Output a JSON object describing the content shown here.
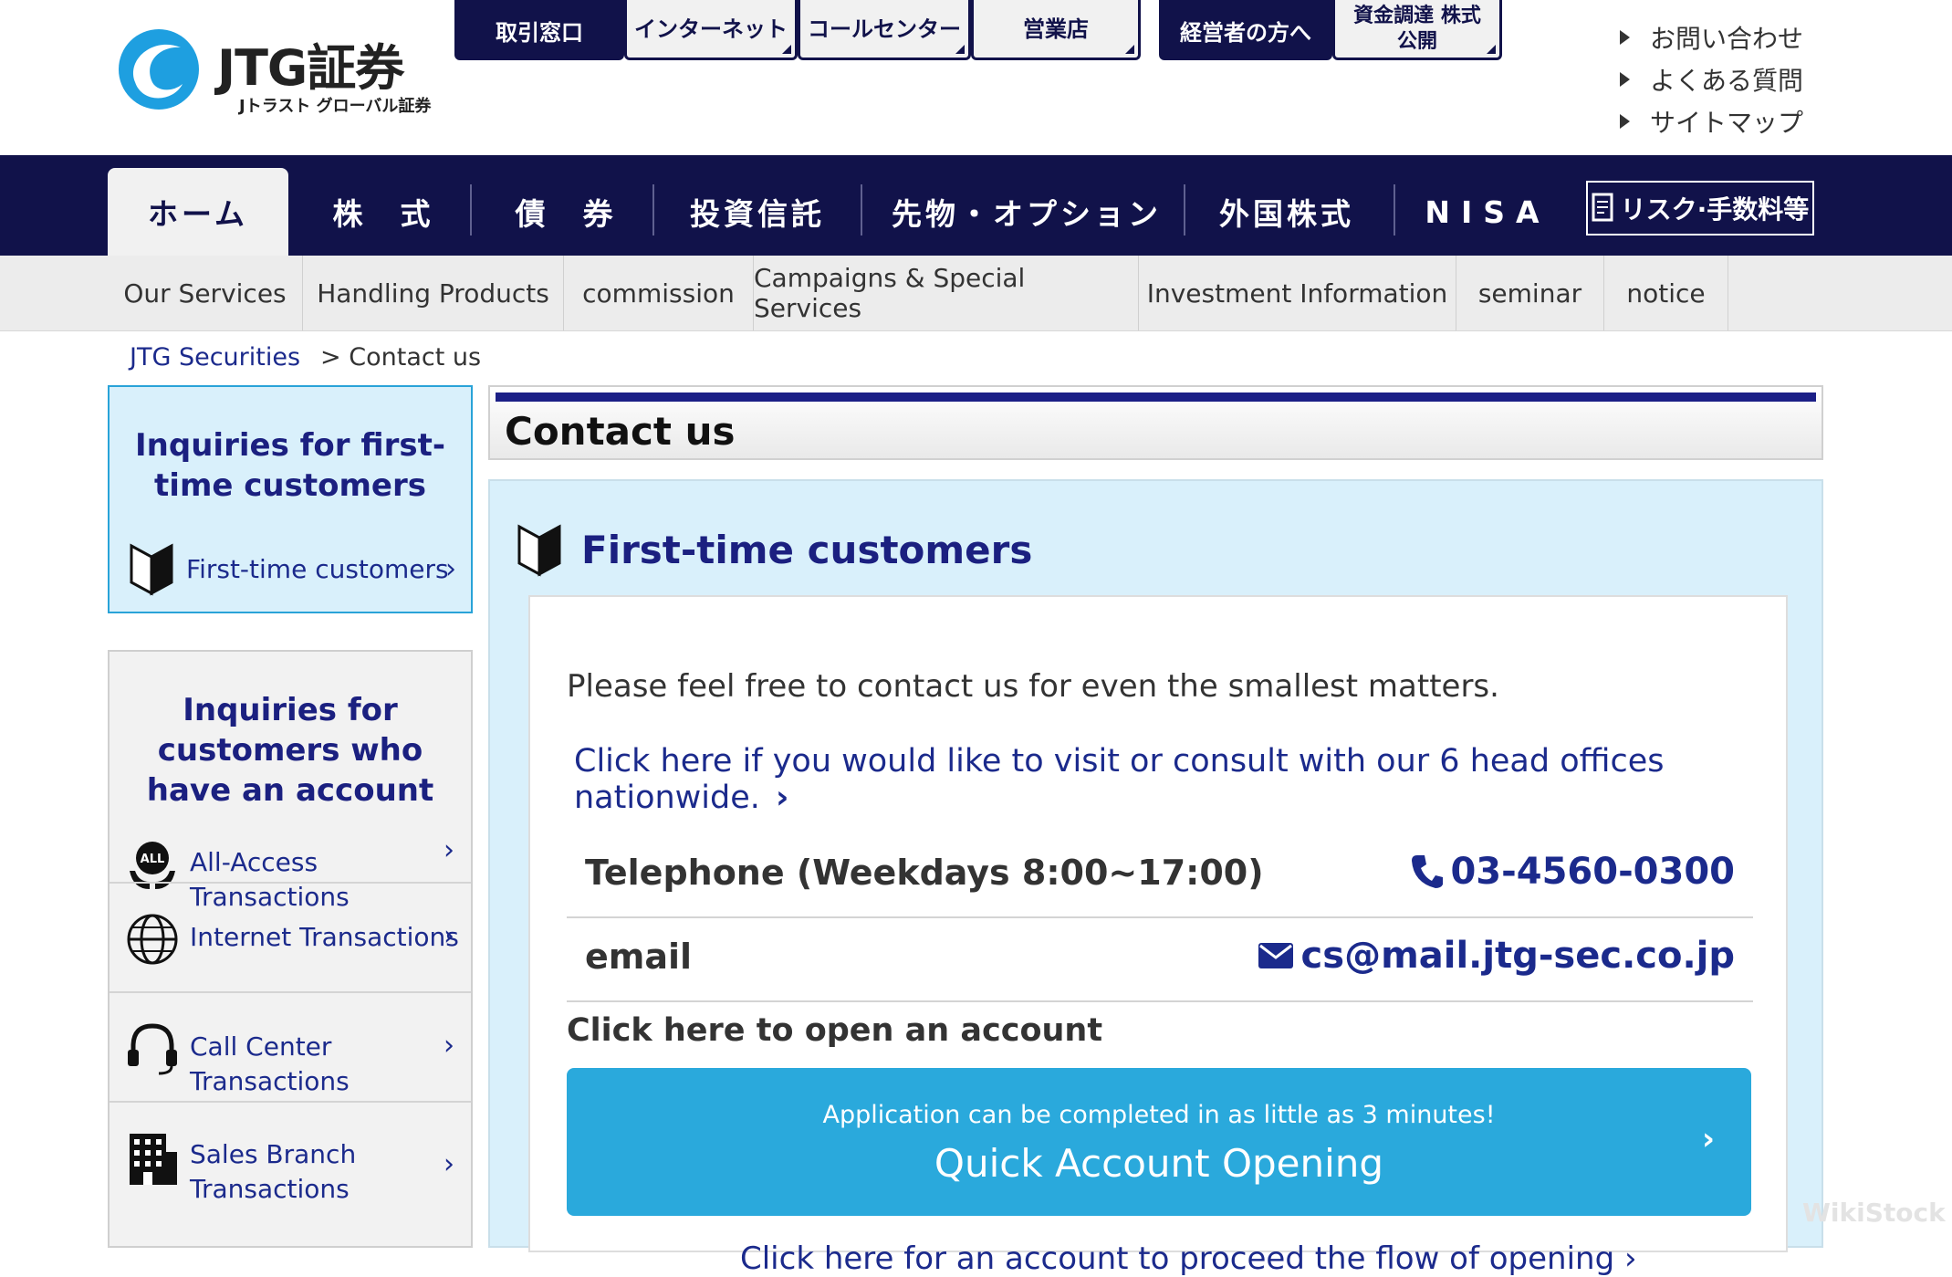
{
  "logo": {
    "brand": "JTG証券",
    "sub": "Jトラスト グローバル証券"
  },
  "top_tabs": [
    {
      "label": "取引窓口",
      "style": "dark"
    },
    {
      "label": "インターネット",
      "style": "light"
    },
    {
      "label": "コールセンター",
      "style": "light"
    },
    {
      "label": "営業店",
      "style": "light"
    },
    {
      "label": "経営者の方へ",
      "style": "dark"
    },
    {
      "label": "資金調達 株式公開",
      "style": "light"
    }
  ],
  "util_links": [
    "お問い合わせ",
    "よくある質問",
    "サイトマップ"
  ],
  "main_nav": {
    "items": [
      "ホーム",
      "株　式",
      "債　券",
      "投資信託",
      "先物・オプション",
      "外国株式",
      "NISA"
    ],
    "risk": "リスク·手数料等"
  },
  "sub_nav": [
    "Our Services",
    "Handling Products",
    "commission",
    "Campaigns & Special Services",
    "Investment Information",
    "seminar",
    "notice"
  ],
  "breadcrumb": {
    "home": "JTG Securities",
    "current": "> Contact us"
  },
  "sidebar": {
    "first_time": {
      "title": "Inquiries for first-time customers",
      "link": "First-time customers"
    },
    "existing": {
      "title": "Inquiries for customers who have an account",
      "rows": [
        {
          "label": "All-Access Transactions",
          "icon": "all-access-icon"
        },
        {
          "label": "Internet Transactions",
          "icon": "globe-icon"
        },
        {
          "label": "Call Center Transactions",
          "icon": "headset-icon"
        },
        {
          "label": "Sales Branch Transactions",
          "icon": "building-icon"
        }
      ]
    }
  },
  "content": {
    "page_title": "Contact us",
    "section_title": "First-time customers",
    "intro": "Please feel free to contact us for even the smallest matters.",
    "visit_link": "Click here if you would like to visit or consult with our 6 head offices nationwide.",
    "phone": {
      "label": "Telephone (Weekdays 8:00~17:00)",
      "value": "03-4560-0300"
    },
    "email": {
      "label": "email",
      "value": "cs@mail.jtg-sec.co.jp"
    },
    "open_label": "Click here to open an account",
    "quick_button": {
      "small": "Application can be completed in as little as 3 minutes!",
      "big": "Quick Account Opening"
    },
    "flow_link": "Click here for an account to proceed the flow of opening"
  },
  "watermark": "WikiStock",
  "colors": {
    "navy": "#11124a",
    "link_blue": "#1b2a8c",
    "accent_blue": "#2aa9dc",
    "panel_bg": "#d9f0fb"
  }
}
